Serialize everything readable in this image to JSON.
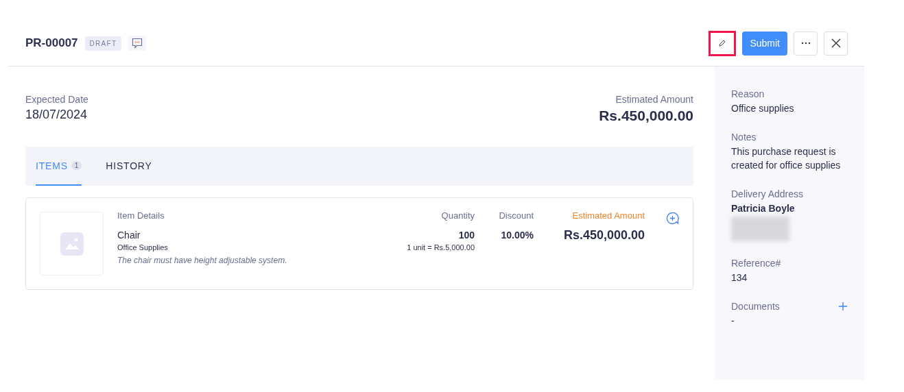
{
  "header": {
    "title": "PR-00007",
    "status": "DRAFT",
    "edit_button": {
      "highlighted": true
    },
    "submit_button": "Submit"
  },
  "summary": {
    "date_label": "Expected Date",
    "date": "18/07/2024",
    "amount_label": "Estimated Amount",
    "amount": "Rs.450,000.00"
  },
  "tabs": [
    {
      "label": "ITEMS",
      "count": "1",
      "selected": true
    },
    {
      "label": "HISTORY",
      "selected": false
    }
  ],
  "items": {
    "columns": [
      "Item Details",
      "Quantity",
      "Discount",
      "Estimated Amount"
    ],
    "rows": [
      {
        "name": "Chair",
        "category": "Office Supplies",
        "note": "The chair must have height adjustable system.",
        "quantity": "100",
        "unit_price": "1 unit = Rs.5,000.00",
        "discount": "10.00%",
        "amount": "Rs.450,000.00"
      }
    ]
  },
  "sidebar": [
    {
      "label": "Reason",
      "value": "Office supplies",
      "bold": false,
      "blurred": false,
      "addable": false
    },
    {
      "label": "Notes",
      "value": "This purchase request is created for office supplies",
      "bold": false,
      "blurred": false,
      "addable": false
    },
    {
      "label": "Delivery Address",
      "value": "Patricia Boyle",
      "bold": true,
      "blurred": true,
      "addable": false
    },
    {
      "label": "Reference#",
      "value": "134",
      "bold": false,
      "blurred": false,
      "addable": false
    },
    {
      "label": "Documents",
      "value": "-",
      "bold": false,
      "blurred": false,
      "addable": true
    }
  ]
}
